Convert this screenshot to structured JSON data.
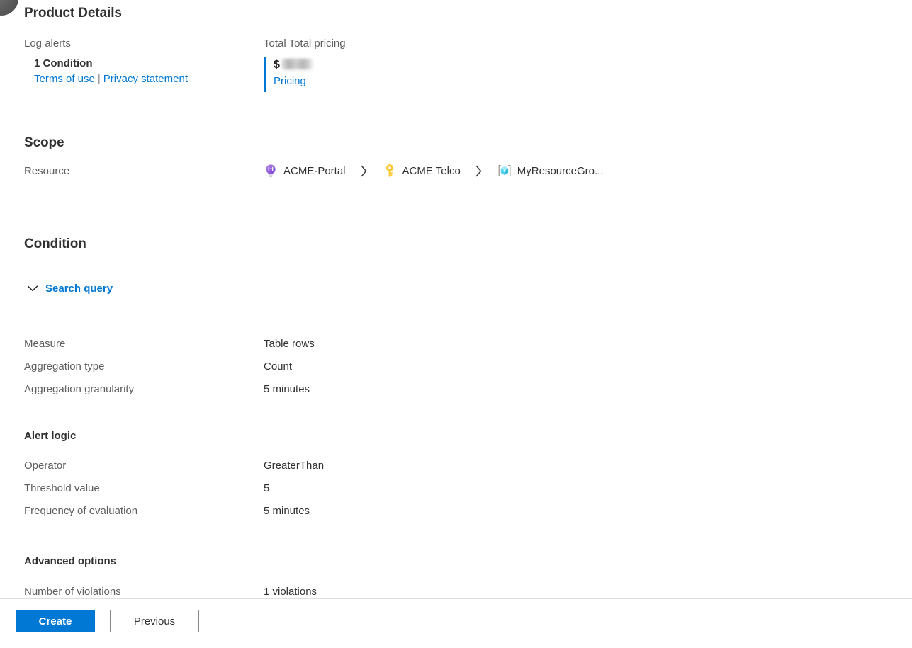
{
  "product_details": {
    "heading": "Product Details",
    "left": {
      "label": "Log alerts",
      "value": "1 Condition",
      "terms_link": "Terms of use",
      "separator": "|",
      "privacy_link": "Privacy statement"
    },
    "right": {
      "label": "Total Total pricing",
      "currency_symbol": "$",
      "amount": "",
      "pricing_link": "Pricing",
      "accent_color": "#0078d4"
    }
  },
  "scope": {
    "heading": "Scope",
    "row_label": "Resource",
    "breadcrumb": [
      {
        "icon": "directory-icon",
        "label": "ACME-Portal"
      },
      {
        "icon": "key-icon",
        "label": "ACME Telco"
      },
      {
        "icon": "resource-group-icon",
        "label": "MyResourceGro..."
      }
    ],
    "separator_icon": "chevron-right-icon"
  },
  "condition": {
    "heading": "Condition",
    "search_query": {
      "label": "Search query",
      "icon": "chevron-down-icon",
      "expanded": true,
      "color": "#0078d4"
    },
    "measure_rows": [
      {
        "key": "Measure",
        "value": "Table rows"
      },
      {
        "key": "Aggregation type",
        "value": "Count"
      },
      {
        "key": "Aggregation granularity",
        "value": "5 minutes"
      }
    ],
    "alert_logic": {
      "heading": "Alert logic",
      "rows": [
        {
          "key": "Operator",
          "value": "GreaterThan"
        },
        {
          "key": "Threshold value",
          "value": "5"
        },
        {
          "key": "Frequency of evaluation",
          "value": "5 minutes"
        }
      ]
    },
    "advanced_options": {
      "heading": "Advanced options",
      "rows": [
        {
          "key": "Number of violations",
          "value": "1 violations"
        }
      ]
    }
  },
  "footer": {
    "create_label": "Create",
    "previous_label": "Previous",
    "primary_color": "#0078d4"
  }
}
